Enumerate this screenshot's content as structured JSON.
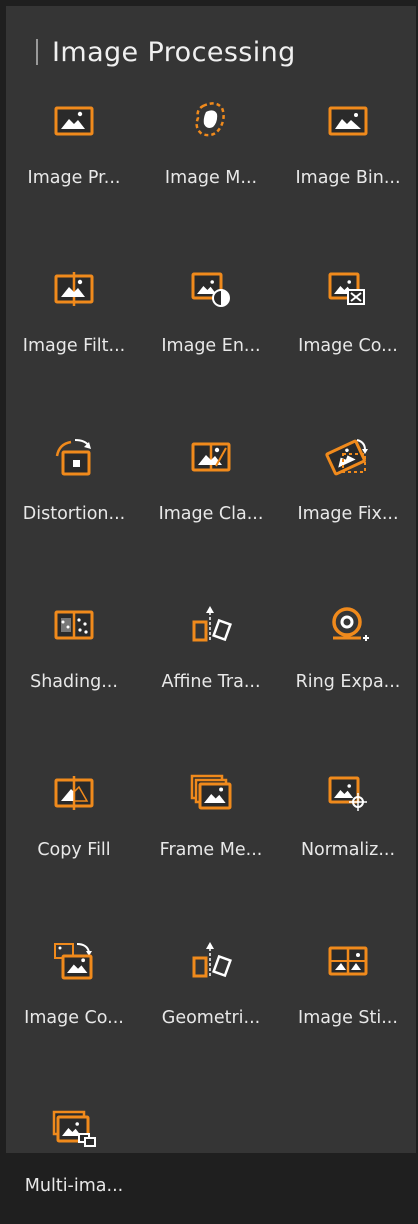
{
  "panel": {
    "title": "Image Processing"
  },
  "accent_color": "#f08a1c",
  "tools": [
    {
      "label": "Image Pr...",
      "icon": "image-icon"
    },
    {
      "label": "Image M...",
      "icon": "mask-icon"
    },
    {
      "label": "Image Bin...",
      "icon": "binary-image-icon"
    },
    {
      "label": "Image Filt...",
      "icon": "filter-image-icon"
    },
    {
      "label": "Image En...",
      "icon": "contrast-image-icon"
    },
    {
      "label": "Image Co...",
      "icon": "compare-image-icon"
    },
    {
      "label": "Distortion...",
      "icon": "distortion-icon"
    },
    {
      "label": "Image Cla...",
      "icon": "classify-image-icon"
    },
    {
      "label": "Image Fix...",
      "icon": "fix-image-icon"
    },
    {
      "label": "Shading...",
      "icon": "shading-icon"
    },
    {
      "label": "Affine Tra...",
      "icon": "affine-transform-icon"
    },
    {
      "label": "Ring Expa...",
      "icon": "ring-expand-icon"
    },
    {
      "label": "Copy Fill",
      "icon": "copy-fill-icon"
    },
    {
      "label": "Frame Me...",
      "icon": "frame-merge-icon"
    },
    {
      "label": "Normaliz...",
      "icon": "normalize-icon"
    },
    {
      "label": "Image Co...",
      "icon": "combine-image-icon"
    },
    {
      "label": "Geometri...",
      "icon": "geometric-transform-icon"
    },
    {
      "label": "Image Sti...",
      "icon": "stitch-image-icon"
    },
    {
      "label": "Multi-ima...",
      "icon": "multi-image-icon"
    }
  ]
}
